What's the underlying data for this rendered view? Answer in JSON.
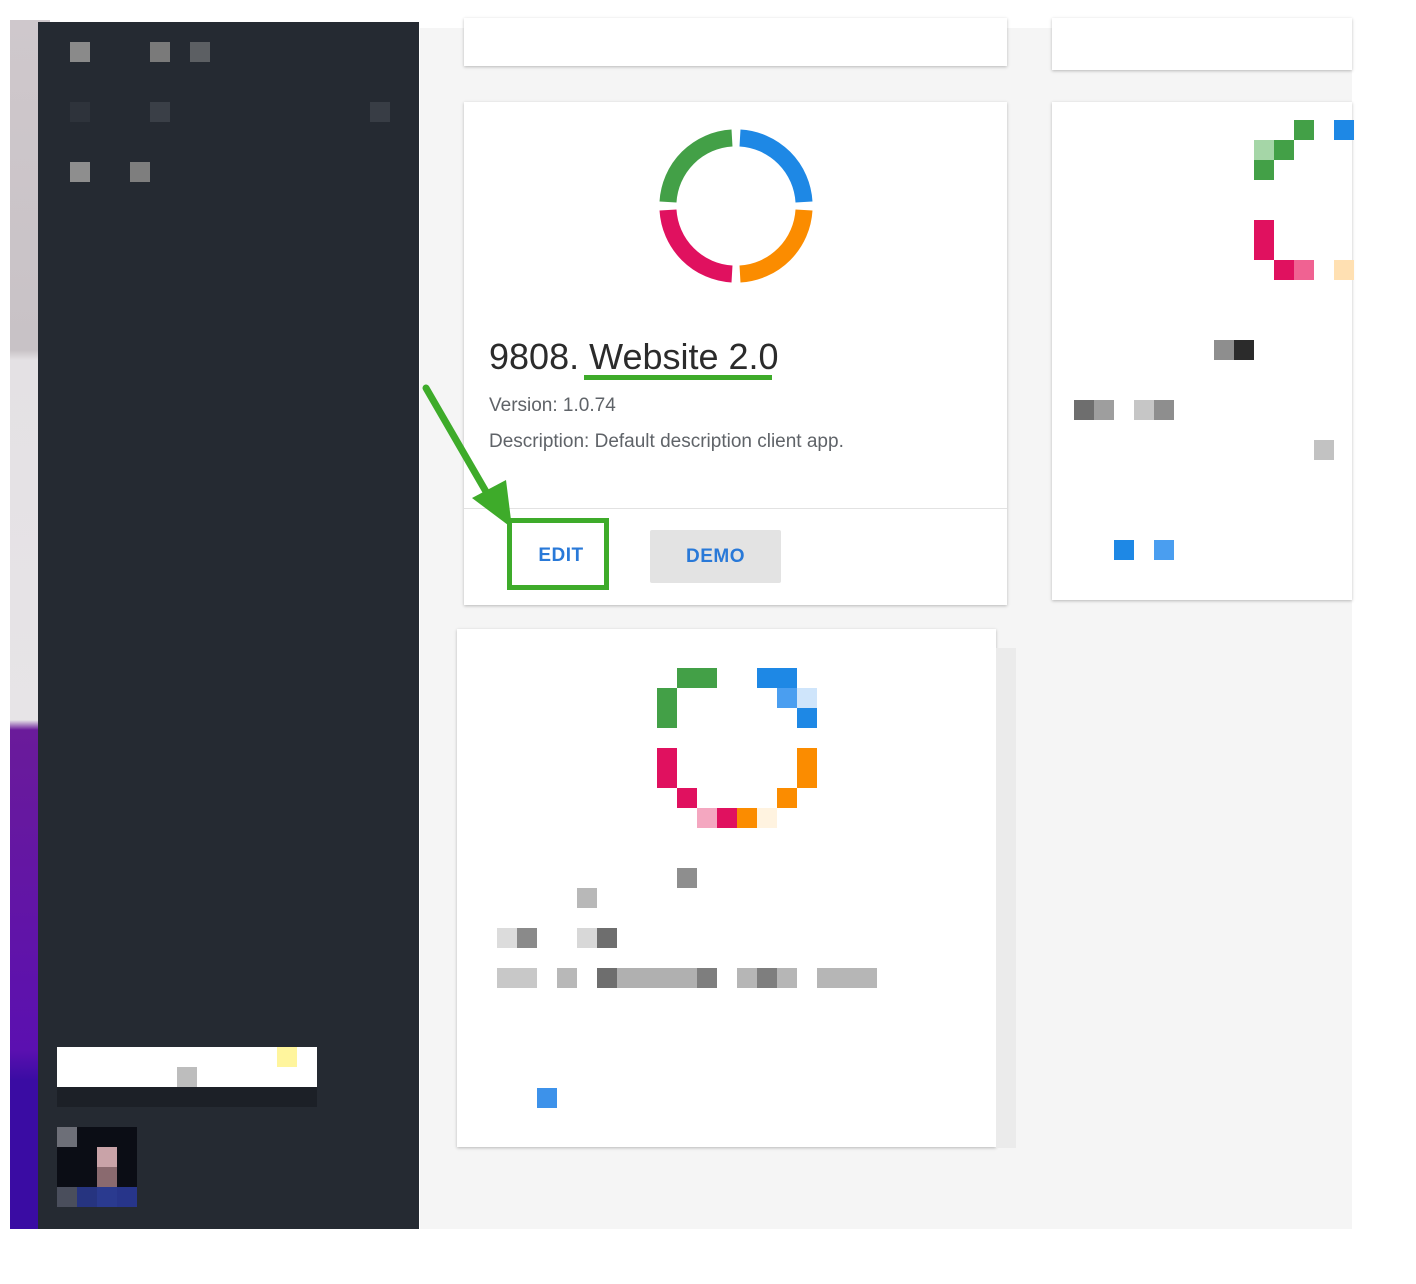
{
  "card": {
    "title_number": "9808.",
    "title_name": "Website 2.0",
    "version": "Version: 1.0.74",
    "description": "Description: Default description client app.",
    "edit_label": "EDIT",
    "demo_label": "DEMO"
  },
  "colors": {
    "sidebar": "#252a32",
    "accent_blue": "#2979d8",
    "highlight_green": "#3eab2a",
    "logo_green": "#43a047",
    "logo_blue": "#1e88e5",
    "logo_red": "#e0115f",
    "logo_orange": "#fb8c00"
  },
  "icons": {
    "app_logo": "segmented-ring-icon",
    "annotation": "arrow-icon"
  }
}
